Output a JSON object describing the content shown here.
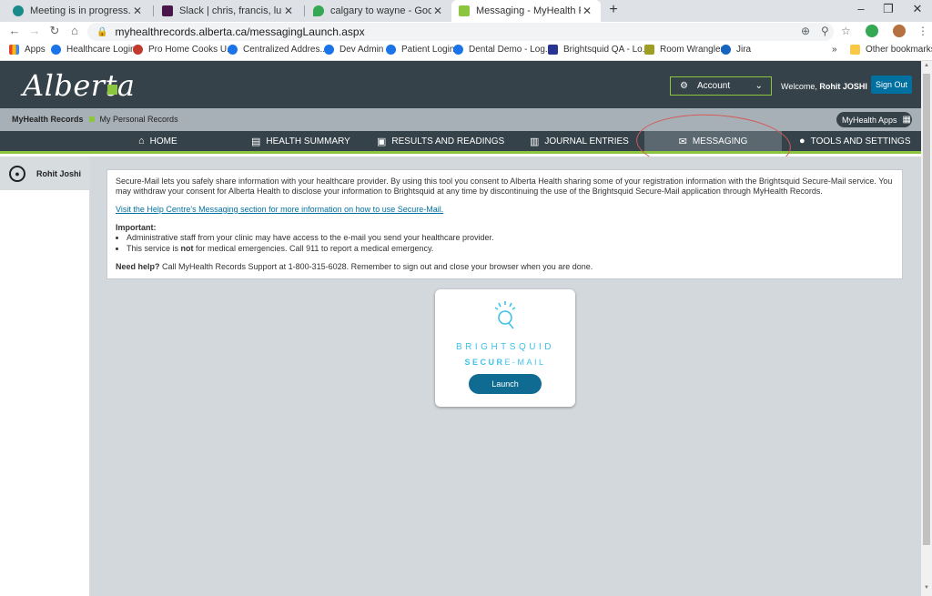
{
  "browser": {
    "tabs": [
      {
        "title": "Meeting is in progress...",
        "favicon_color": "#1a8a8a"
      },
      {
        "title": "Slack | chris, francis, luiz, mark.ey",
        "favicon_color": "#4a154b"
      },
      {
        "title": "calgary to wayne - Google Maps",
        "favicon_color": "#34a853"
      },
      {
        "title": "Messaging - MyHealth Records",
        "favicon_color": "#8cc63f"
      }
    ],
    "new_tab": "+",
    "controls": {
      "minimize": "–",
      "restore": "❐",
      "close": "✕"
    },
    "url": "myhealthrecords.alberta.ca/messagingLaunch.aspx",
    "bookmarks": [
      {
        "label": "Apps"
      },
      {
        "label": "Healthcare Login"
      },
      {
        "label": "Pro Home Cooks U..."
      },
      {
        "label": "Centralized Addres..."
      },
      {
        "label": "Dev Admin"
      },
      {
        "label": "Patient Login"
      },
      {
        "label": "Dental Demo - Log..."
      },
      {
        "label": "Brightsquid QA - Lo..."
      },
      {
        "label": "Room Wrangler"
      },
      {
        "label": "Jira"
      }
    ],
    "bookmarks_overflow": "»",
    "other_bookmarks": "Other bookmarks"
  },
  "site": {
    "logo_text": "Alberta",
    "account_label": "Account",
    "welcome_prefix": "Welcome, ",
    "user_name": "Rohit JOSHI",
    "sign_out": "Sign Out",
    "breadcrumb": {
      "root": "MyHealth Records",
      "current": "My Personal Records"
    },
    "myhealth_apps": "MyHealth Apps",
    "nav": [
      {
        "label": "HOME",
        "icon": "home-icon"
      },
      {
        "label": "HEALTH SUMMARY",
        "icon": "summary-icon"
      },
      {
        "label": "RESULTS AND READINGS",
        "icon": "clipboard-icon"
      },
      {
        "label": "JOURNAL ENTRIES",
        "icon": "journal-icon"
      },
      {
        "label": "MESSAGING",
        "icon": "envelope-icon",
        "active": true
      },
      {
        "label": "TOOLS AND SETTINGS",
        "icon": "user-icon"
      }
    ],
    "accent_color": "#8cc63f",
    "header_color": "#36424a"
  },
  "sidebar": {
    "profile_name": "Rohit Joshi"
  },
  "info": {
    "intro": "Secure-Mail lets you safely share information with your healthcare provider. By using this tool you consent to Alberta Health sharing some of your registration information with the Brightsquid Secure-Mail service. You may withdraw your consent for Alberta Health to disclose your information to Brightsquid at any time by discontinuing the use of the Brightsquid Secure-Mail application through MyHealth Records.",
    "help_link": "Visit the Help Centre's Messaging section for more information on how to use Secure-Mail.",
    "important_label": "Important:",
    "bullet1": "Administrative staff from your clinic may have access to the e-mail you send your healthcare provider.",
    "bullet2_pre": "This service is ",
    "bullet2_strong": "not",
    "bullet2_post": " for medical emergencies. Call 911 to report a medical emergency.",
    "need_help_label": "Need help?",
    "need_help_text": " Call MyHealth Records Support at 1-800-315-6028. Remember to sign out and close your browser when you are done."
  },
  "card": {
    "brand": "BRIGHTSQUID",
    "product_bold": "SECUR",
    "product_rest": "E-MAIL",
    "launch": "Launch"
  }
}
